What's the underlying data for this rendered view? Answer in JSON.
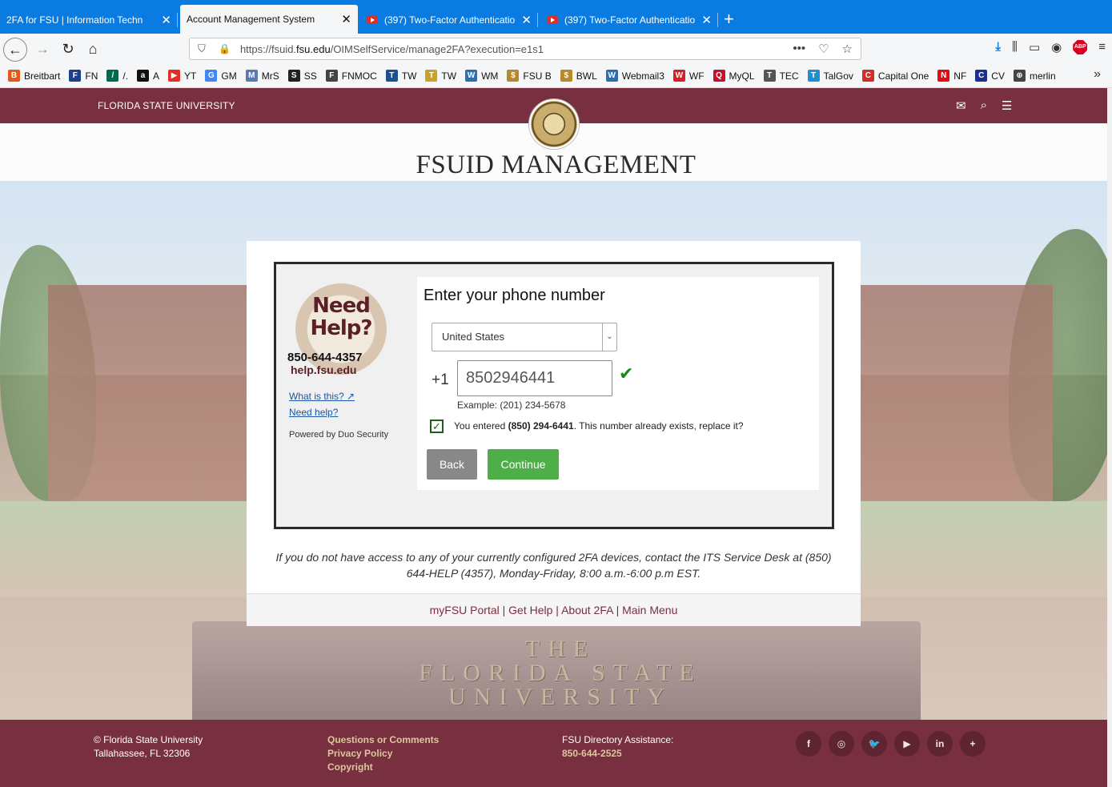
{
  "tabs": [
    {
      "title": "2FA for FSU | Information Techn",
      "icon": "fsu-seal"
    },
    {
      "title": "Account Management System",
      "icon": "fsu-seal"
    },
    {
      "title": "(397) Two-Factor Authenticatio",
      "icon": "youtube"
    },
    {
      "title": "(397) Two-Factor Authenticatio",
      "icon": "youtube"
    }
  ],
  "address": {
    "prefix": "https://fsuid.",
    "domain": "fsu.edu",
    "path": "/OIMSelfService/manage2FA?execution=e1s1"
  },
  "bookmarks": [
    {
      "label": "Breitbart",
      "color": "#e4591b",
      "glyph": "B"
    },
    {
      "label": "FN",
      "color": "#1d3f8c",
      "glyph": "F"
    },
    {
      "label": "/.",
      "color": "#006a4e",
      "glyph": "/"
    },
    {
      "label": "A",
      "color": "#111111",
      "glyph": "a"
    },
    {
      "label": "YT",
      "color": "#e52d27",
      "glyph": "▶"
    },
    {
      "label": "GM",
      "color": "#4285f4",
      "glyph": "G"
    },
    {
      "label": "MrS",
      "color": "#5a7ab5",
      "glyph": "M"
    },
    {
      "label": "SS",
      "color": "#222222",
      "glyph": "S"
    },
    {
      "label": "FNMOC",
      "color": "#444444",
      "glyph": "F"
    },
    {
      "label": "TW",
      "color": "#1d4f91",
      "glyph": "T"
    },
    {
      "label": "TW",
      "color": "#c9a227",
      "glyph": "T"
    },
    {
      "label": "WM",
      "color": "#2c6fb3",
      "glyph": "W"
    },
    {
      "label": "FSU B",
      "color": "#b8892a",
      "glyph": "$"
    },
    {
      "label": "BWL",
      "color": "#b8892a",
      "glyph": "$"
    },
    {
      "label": "Webmail3",
      "color": "#2c6fb3",
      "glyph": "W"
    },
    {
      "label": "WF",
      "color": "#d71e28",
      "glyph": "W"
    },
    {
      "label": "MyQL",
      "color": "#c8102e",
      "glyph": "Q"
    },
    {
      "label": "TEC",
      "color": "#555555",
      "glyph": "T"
    },
    {
      "label": "TalGov",
      "color": "#1f8fd1",
      "glyph": "T"
    },
    {
      "label": "Capital One",
      "color": "#d03027",
      "glyph": "C"
    },
    {
      "label": "NF",
      "color": "#e50914",
      "glyph": "N"
    },
    {
      "label": "CV",
      "color": "#1d2f8c",
      "glyph": "C"
    },
    {
      "label": "merlin",
      "color": "#444444",
      "glyph": "⊕"
    }
  ],
  "site": {
    "university": "FLORIDA STATE UNIVERSITY",
    "title": "FSUID MANAGEMENT"
  },
  "duo": {
    "help_big": "Need Help?",
    "help_phone": "850-644-4357",
    "help_url": "help.fsu.edu",
    "what_is_this": "What is this?",
    "need_help": "Need help?",
    "powered_by": "Powered by Duo Security",
    "heading": "Enter your phone number",
    "country": "United States",
    "country_code": "+1",
    "phone_value": "8502946441",
    "example": "Example: (201) 234-5678",
    "confirm_prefix": "You entered ",
    "confirm_number": "(850) 294-6441",
    "confirm_suffix": ". This number already exists, replace it?",
    "back_label": "Back",
    "continue_label": "Continue"
  },
  "note": "If you do not have access to any of your currently configured 2FA devices, contact the ITS Service Desk at (850) 644-HELP (4357), Monday-Friday, 8:00 a.m.-6:00 p.m EST.",
  "card_links": [
    "myFSU Portal",
    "Get Help",
    "About 2FA",
    "Main Menu"
  ],
  "engraving": [
    "THE",
    "FLORIDA STATE",
    "UNIVERSITY"
  ],
  "footer": {
    "copyright": "© Florida State University",
    "address": "Tallahassee, FL 32306",
    "links": [
      "Questions or Comments",
      "Privacy Policy",
      "Copyright"
    ],
    "directory_label": "FSU Directory Assistance:",
    "directory_phone": "850-644-2525",
    "social": [
      {
        "name": "facebook",
        "glyph": "f"
      },
      {
        "name": "instagram",
        "glyph": "◎"
      },
      {
        "name": "twitter",
        "glyph": "🐦"
      },
      {
        "name": "youtube",
        "glyph": "▶"
      },
      {
        "name": "linkedin",
        "glyph": "in"
      },
      {
        "name": "more",
        "glyph": "+"
      }
    ]
  },
  "colors": {
    "garnet": "#782f40",
    "gold": "#dcc79c",
    "firefox_blue": "#0a7be0",
    "continue_green": "#4eae47"
  }
}
